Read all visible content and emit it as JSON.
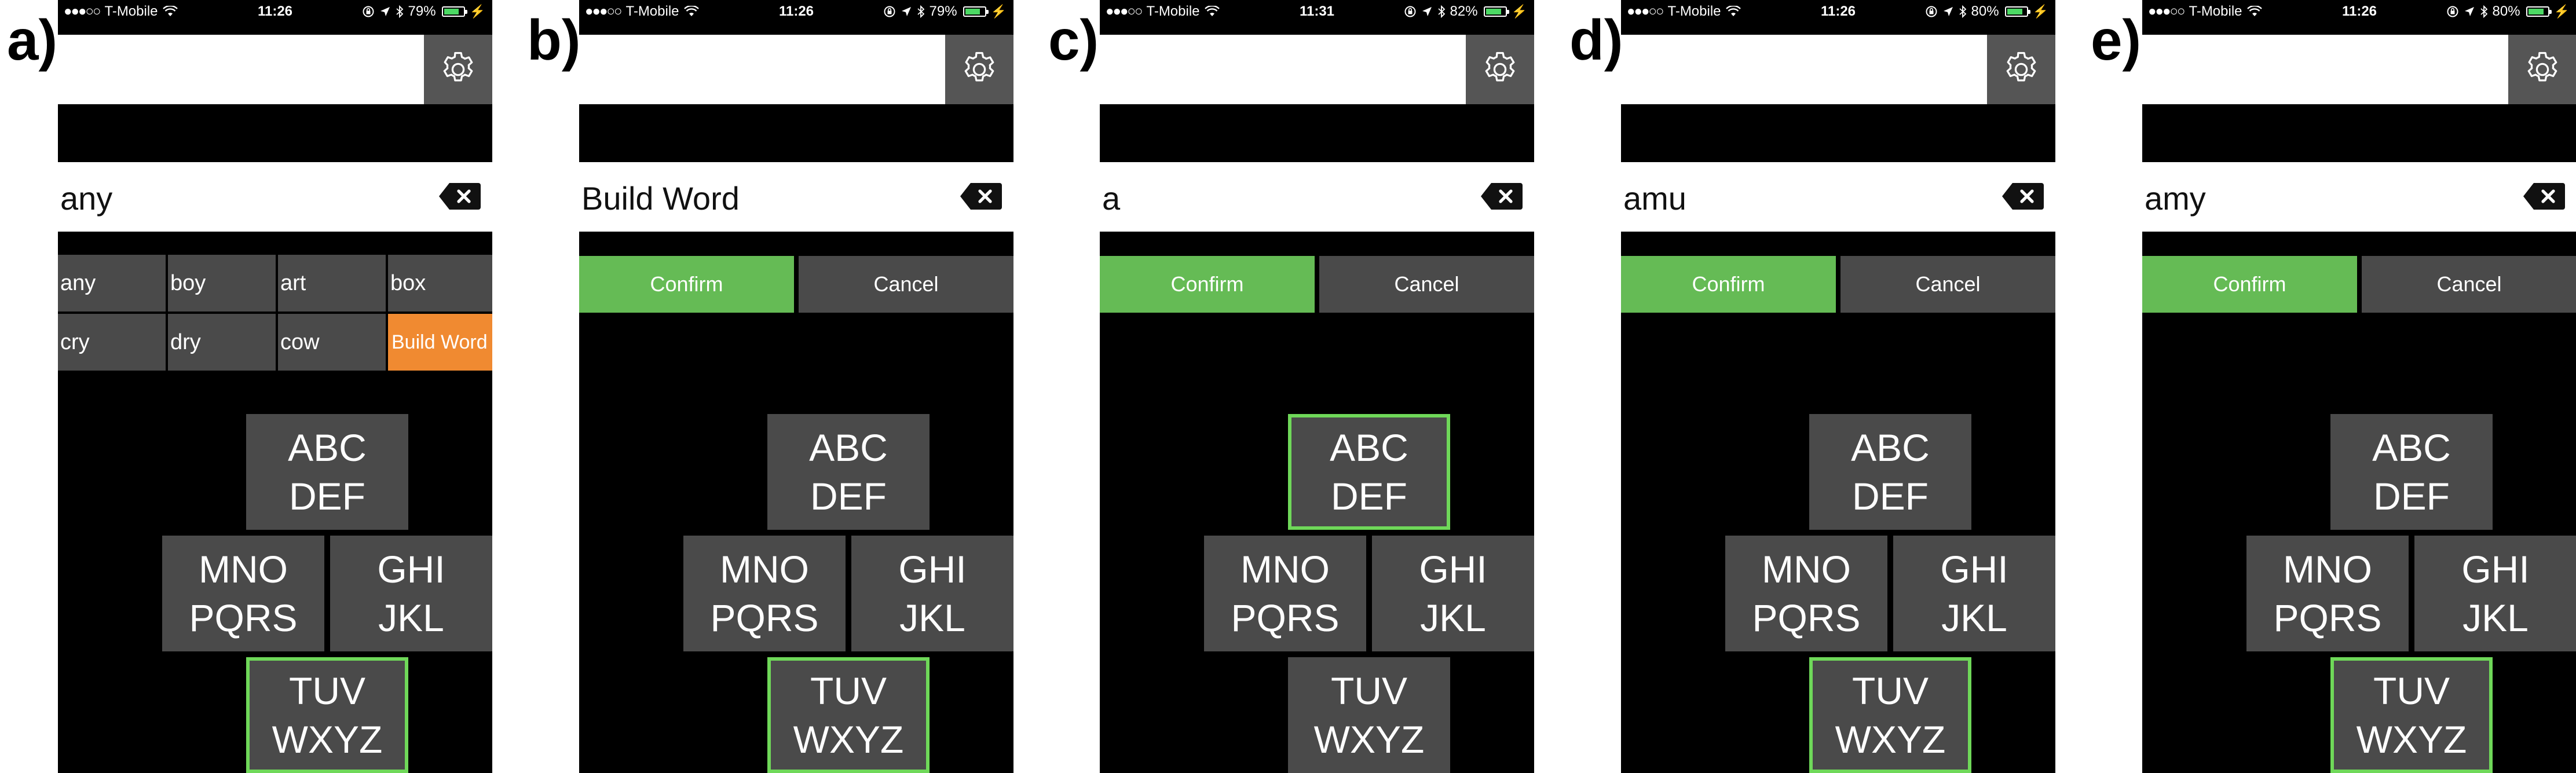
{
  "panels": [
    {
      "label": "a)",
      "status": {
        "carrier": "T-Mobile",
        "time": "11:26",
        "battery": "79%",
        "battery_level": 0.79
      },
      "word": "any",
      "mode": "suggestions",
      "suggestions": [
        "any",
        "boy",
        "art",
        "box",
        "cry",
        "dry",
        "cow",
        "Build Word"
      ],
      "highlighted_key": "tuv"
    },
    {
      "label": "b)",
      "status": {
        "carrier": "T-Mobile",
        "time": "11:26",
        "battery": "79%",
        "battery_level": 0.79
      },
      "word": "Build Word",
      "mode": "confirm",
      "highlighted_key": "tuv"
    },
    {
      "label": "c)",
      "status": {
        "carrier": "T-Mobile",
        "time": "11:31",
        "battery": "82%",
        "battery_level": 0.82
      },
      "word": "a",
      "mode": "confirm",
      "highlighted_key": "abc"
    },
    {
      "label": "d)",
      "status": {
        "carrier": "T-Mobile",
        "time": "11:26",
        "battery": "80%",
        "battery_level": 0.8
      },
      "word": "amu",
      "mode": "confirm",
      "highlighted_key": "tuv"
    },
    {
      "label": "e)",
      "status": {
        "carrier": "T-Mobile",
        "time": "11:26",
        "battery": "80%",
        "battery_level": 0.8
      },
      "word": "amy",
      "mode": "confirm",
      "highlighted_key": "tuv"
    }
  ],
  "buttons": {
    "confirm": "Confirm",
    "cancel": "Cancel"
  },
  "keys": {
    "abc": [
      "ABC",
      "DEF"
    ],
    "mno": [
      "MNO",
      "PQRS"
    ],
    "ghi": [
      "GHI",
      "JKL"
    ],
    "tuv": [
      "TUV",
      "WXYZ"
    ]
  },
  "icons": {
    "settings": "gear-icon",
    "backspace": "backspace-icon",
    "wifi": "wifi-icon",
    "bluetooth": "bluetooth-icon",
    "location": "location-arrow-icon",
    "lock": "orientation-lock-icon"
  },
  "colors": {
    "confirm": "#65bb55",
    "build_word": "#f08a31",
    "key_bg": "#4a4a4a",
    "highlight": "#6fd859",
    "gear_bg": "#555555"
  }
}
